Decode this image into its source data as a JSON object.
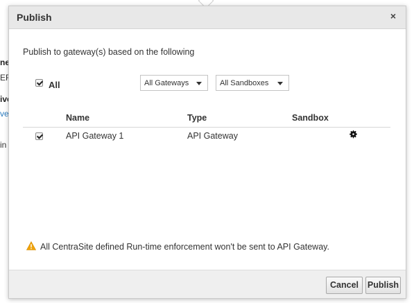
{
  "background": {
    "fragments": [
      "ne",
      "EF",
      "ive",
      "ver",
      "in"
    ]
  },
  "dialog": {
    "title": "Publish",
    "close_label": "×",
    "intro": "Publish to gateway(s) based on the following",
    "all_label": "All",
    "all_checked": true,
    "gateway_filter": {
      "selected": "All Gateways"
    },
    "sandbox_filter": {
      "selected": "All Sandboxes"
    },
    "table": {
      "columns": [
        "Name",
        "Type",
        "Sandbox"
      ],
      "rows": [
        {
          "checked": true,
          "name": "API Gateway 1",
          "type": "API Gateway",
          "sandbox": "",
          "action_icon": "gear-icon"
        }
      ]
    },
    "warning": {
      "icon": "warning-icon",
      "color": "#f0a30a",
      "text": "All CentraSite defined Run-time enforcement won't be sent to API Gateway."
    },
    "buttons": {
      "cancel": "Cancel",
      "publish": "Publish"
    }
  }
}
